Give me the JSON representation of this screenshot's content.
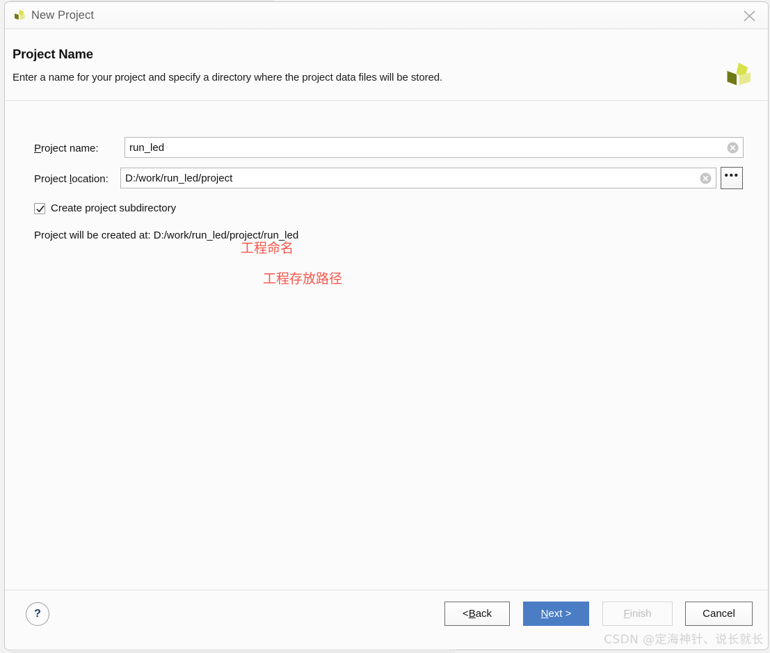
{
  "window": {
    "title": "New Project",
    "logo_icon": "vivado-tri-blade-logo",
    "close_icon": "close-icon"
  },
  "header": {
    "title": "Project Name",
    "subtitle": "Enter a name for your project and specify a directory where the project data files will be stored.",
    "logo_icon": "vivado-tri-blade-logo"
  },
  "form": {
    "project_name": {
      "label_pre": "P",
      "label_post": "roject name:",
      "value": "run_led",
      "clear_icon": "clear-circle-x-icon",
      "annotation": "工程命名"
    },
    "project_location": {
      "label_pre": "Project ",
      "label_mid": "l",
      "label_post": "ocation:",
      "value": "D:/work/run_led/project",
      "clear_icon": "clear-circle-x-icon",
      "browse_label": "•••",
      "annotation": "工程存放路径"
    },
    "create_subdirectory": {
      "label": "Create project subdirectory",
      "checked": true
    },
    "created_at_text": "Project will be created at: D:/work/run_led/project/run_led"
  },
  "footer": {
    "help_label": "?",
    "back": {
      "pre": "< ",
      "key": "B",
      "post": "ack"
    },
    "next": {
      "key": "N",
      "post": "ext >"
    },
    "finish": {
      "key": "F",
      "post": "inish",
      "disabled": true
    },
    "cancel": {
      "label": "Cancel"
    }
  },
  "watermark": "CSDN @定海神针、说长就长",
  "colors": {
    "primary_blue": "#4a7dc4",
    "annotation_red": "#f8564b",
    "logo_dark": "#6f7a14",
    "logo_bright": "#d8e04a",
    "logo_light": "#e6ea8f",
    "help_blue": "#1f3864"
  }
}
